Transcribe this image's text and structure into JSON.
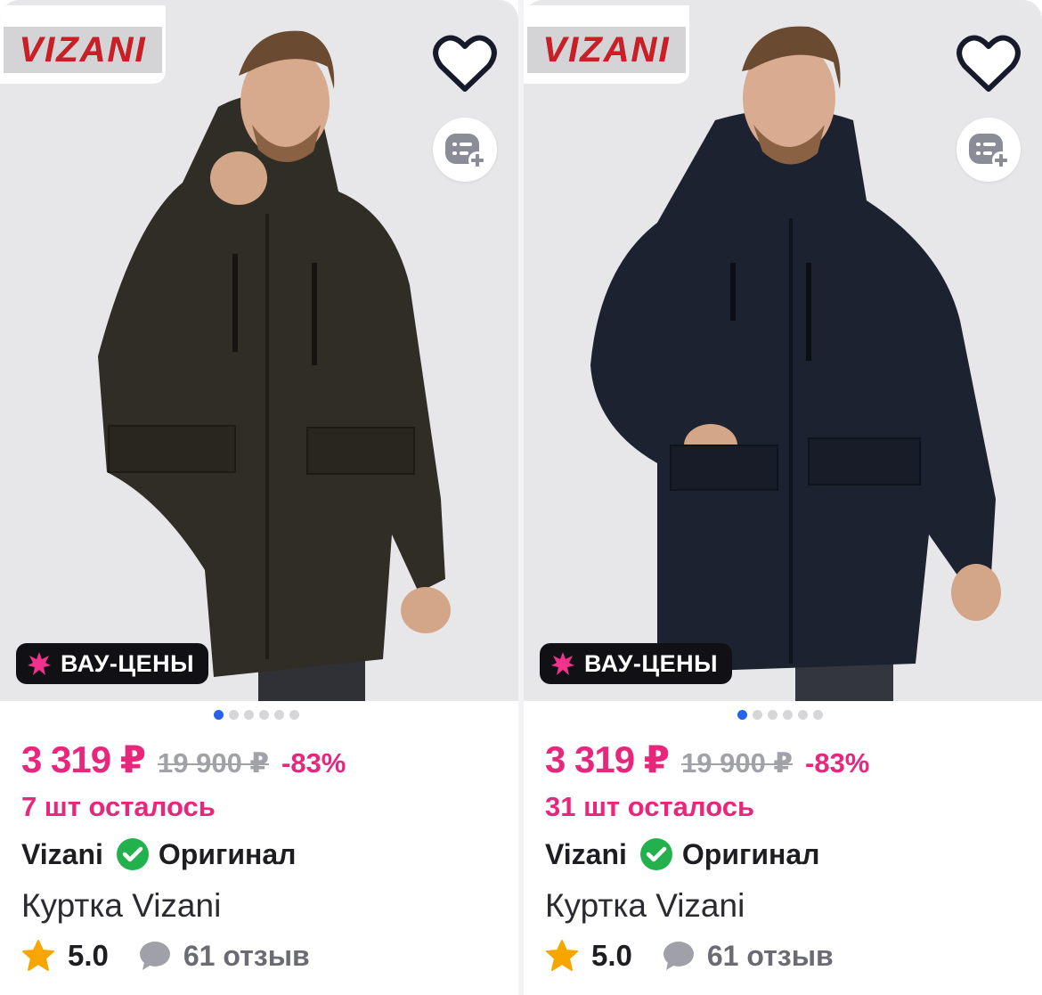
{
  "products": [
    {
      "brand_logo": "VIZANI",
      "jacket_color": "#2f2d25",
      "promo_label": "ВАУ-ЦЕНЫ",
      "price": "3 319 ₽",
      "old_price": "19 900 ₽",
      "discount": "-83%",
      "stock": "7 шт осталось",
      "brand": "Vizani",
      "original_label": "Оригинал",
      "title": "Куртка Vizani",
      "rating": "5.0",
      "reviews": "61 отзыв",
      "images_count": 6,
      "active_image": 1
    },
    {
      "brand_logo": "VIZANI",
      "jacket_color": "#1c2230",
      "promo_label": "ВАУ-ЦЕНЫ",
      "price": "3 319 ₽",
      "old_price": "19 900 ₽",
      "discount": "-83%",
      "stock": "31 шт осталось",
      "brand": "Vizani",
      "original_label": "Оригинал",
      "title": "Куртка Vizani",
      "rating": "5.0",
      "reviews": "61 отзыв",
      "images_count": 6,
      "active_image": 1
    }
  ],
  "colors": {
    "accent_pink": "#e8277c",
    "dot_active": "#2563eb",
    "check_green": "#22b14c",
    "star_orange": "#f7a600"
  },
  "icons": {
    "favorite": "heart-icon",
    "add_to_list": "add-to-list-icon",
    "promo": "burst-star-icon",
    "original": "check-badge-icon",
    "rating": "star-icon",
    "reviews": "chat-bubble-icon"
  }
}
